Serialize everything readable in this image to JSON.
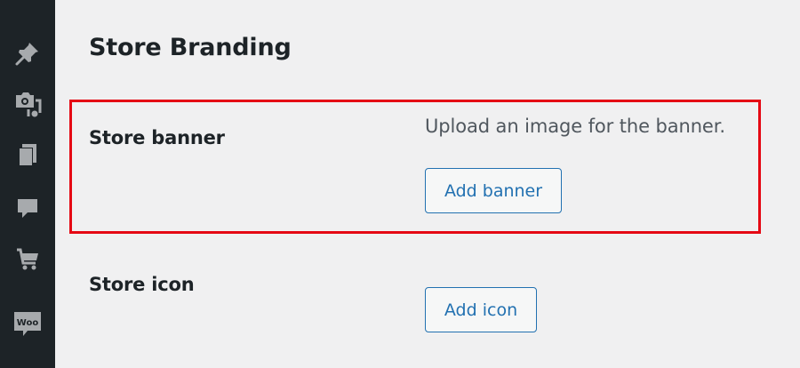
{
  "sidebar": {
    "items": [
      {
        "icon": "pin-icon"
      },
      {
        "icon": "media-icon"
      },
      {
        "icon": "pages-icon"
      },
      {
        "icon": "comments-icon"
      },
      {
        "icon": "cart-icon"
      },
      {
        "icon": "woo-icon",
        "label": "Woo"
      }
    ]
  },
  "main": {
    "section_title": "Store Branding",
    "highlight_color": "#e50914",
    "store_banner": {
      "label": "Store banner",
      "description": "Upload an image for the banner.",
      "button_label": "Add banner"
    },
    "store_icon": {
      "label": "Store icon",
      "button_label": "Add icon"
    }
  },
  "colors": {
    "sidebar_bg": "#1d2327",
    "page_bg": "#f0f0f1",
    "accent": "#2271b1",
    "icon": "#a7aaad"
  }
}
